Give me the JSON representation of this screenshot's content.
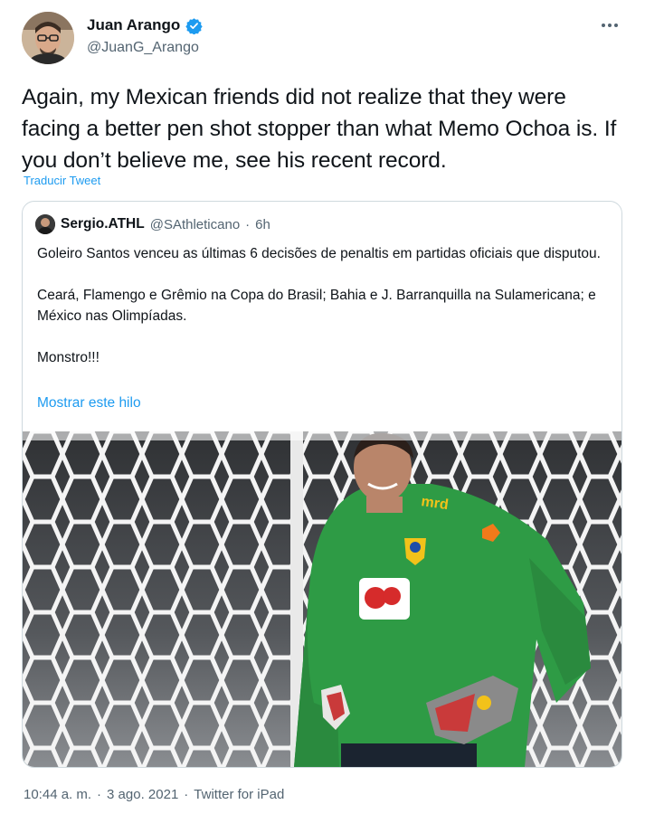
{
  "author": {
    "name": "Juan Arango",
    "handle": "@JuanG_Arango",
    "verified": true
  },
  "tweet": {
    "text": "Again, my Mexican friends did not realize that they were facing a better pen shot stopper than what Memo Ochoa is.  If you don’t believe me, see his recent record.",
    "translate_label": "Traducir Tweet"
  },
  "quoted": {
    "name": "Sergio.ATHL",
    "handle": "@SAthleticano",
    "separator": "·",
    "time": "6h",
    "paragraphs": [
      "Goleiro Santos venceu as últimas 6 decisões de penaltis em partidas oficiais que disputou.",
      "Ceará, Flamengo e Grêmio na Copa do Brasil; Bahia e J. Barranquilla na Sulamericana; e México nas Olimpíadas.",
      "Monstro!!!"
    ],
    "show_thread_label": "Mostrar este hilo",
    "image": {
      "shirt_sponsor": "mrd"
    }
  },
  "meta": {
    "time": "10:44 a. m.",
    "separator": "·",
    "date": "3 ago. 2021",
    "client": "Twitter for iPad"
  },
  "colors": {
    "link": "#1d9bf0",
    "verified": "#1d9bf0",
    "secondary_text": "#536471",
    "border": "#cfd9de",
    "jersey_green": "#2e9b45",
    "jersey_yellow": "#f2c21a"
  },
  "icons": [
    "verified-badge-icon",
    "more-options-icon"
  ]
}
